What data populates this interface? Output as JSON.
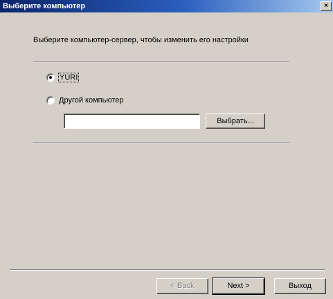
{
  "window": {
    "title": "Выберите компьютер",
    "close_glyph": "×"
  },
  "subtitle": "Выберите компьютер-сервер, чтобы изменить его настройки",
  "options": {
    "local": {
      "label": "YURI",
      "checked": true
    },
    "other": {
      "label": "Другой компьютер",
      "checked": false
    }
  },
  "computer_input": {
    "value": "",
    "placeholder": ""
  },
  "browse_button": "Выбрать...",
  "footer": {
    "back_label": "< Back",
    "next_label": "Next >",
    "exit_label": "Выход"
  }
}
